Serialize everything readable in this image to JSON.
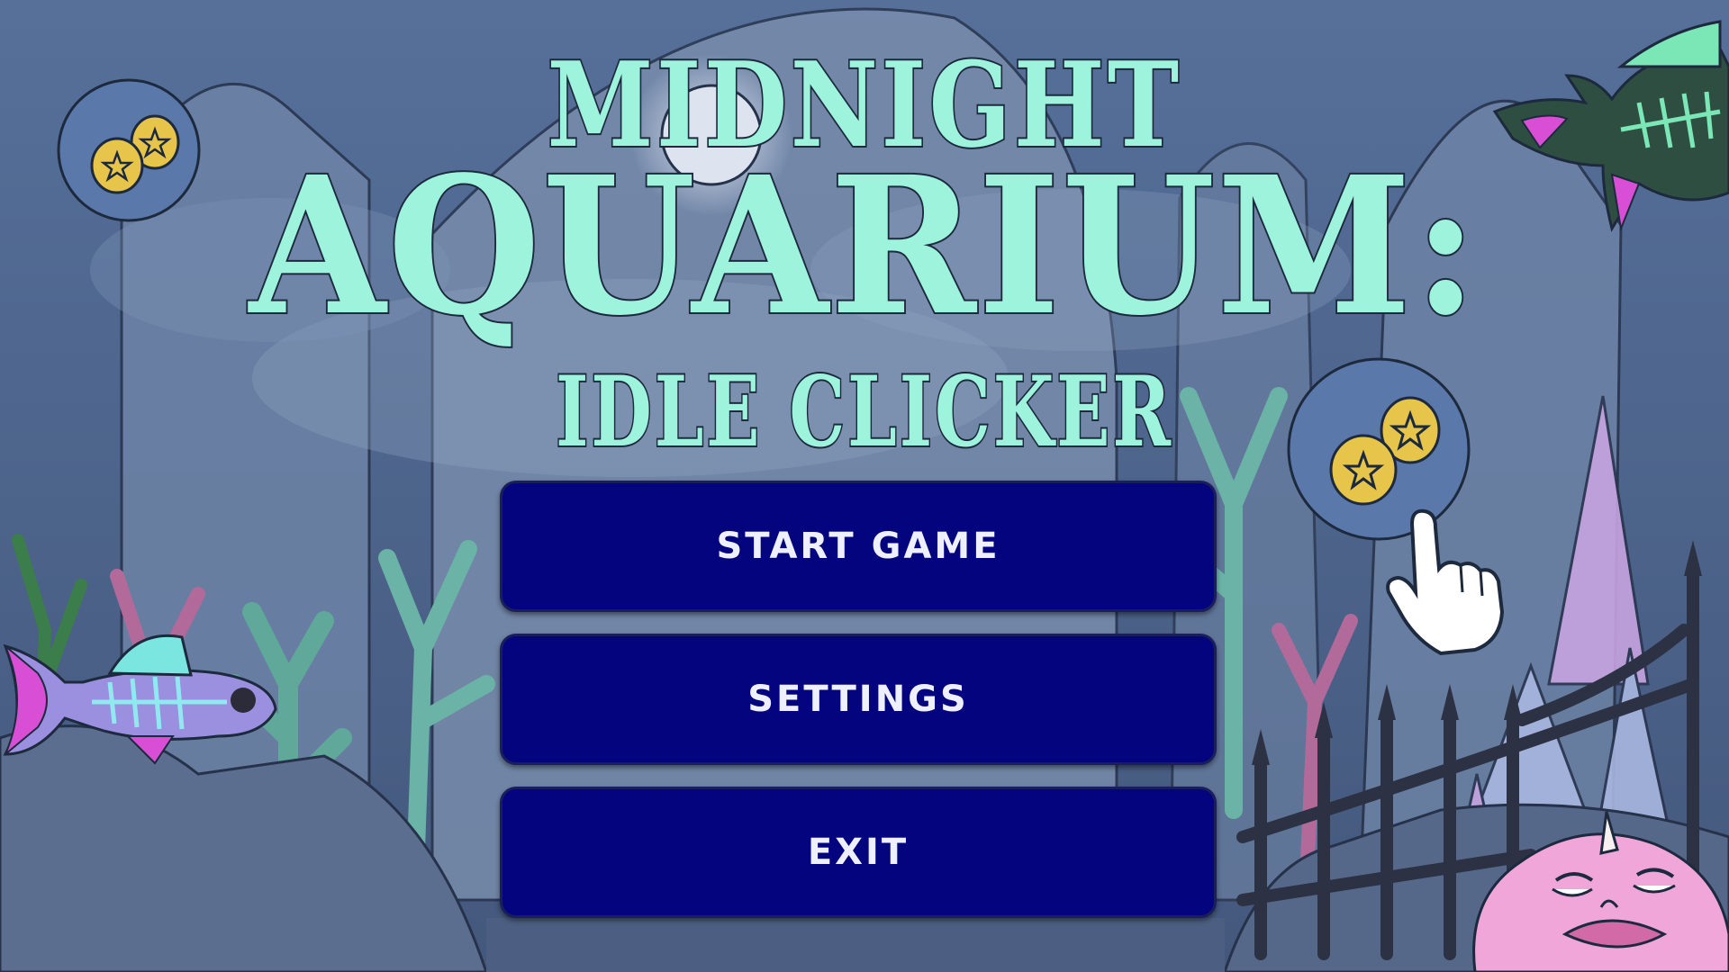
{
  "title": {
    "line1": "MIDNIGHT",
    "line2": "AQUARIUM:",
    "line3": "IDLE CLICKER"
  },
  "menu": {
    "start_label": "START GAME",
    "settings_label": "SETTINGS",
    "exit_label": "EXIT"
  },
  "colors": {
    "title_fill": "#9ef3dc",
    "button_bg": "#04047f",
    "button_text": "#eef0ff",
    "background": "#4a6488"
  },
  "icons": [
    "coin-badge-icon",
    "coin-badge-icon",
    "pointing-hand-cursor-icon",
    "skeleton-fish-icon",
    "skeleton-fish-icon",
    "pink-blob-creature-icon",
    "iron-fence",
    "coral",
    "crystals",
    "moon"
  ]
}
